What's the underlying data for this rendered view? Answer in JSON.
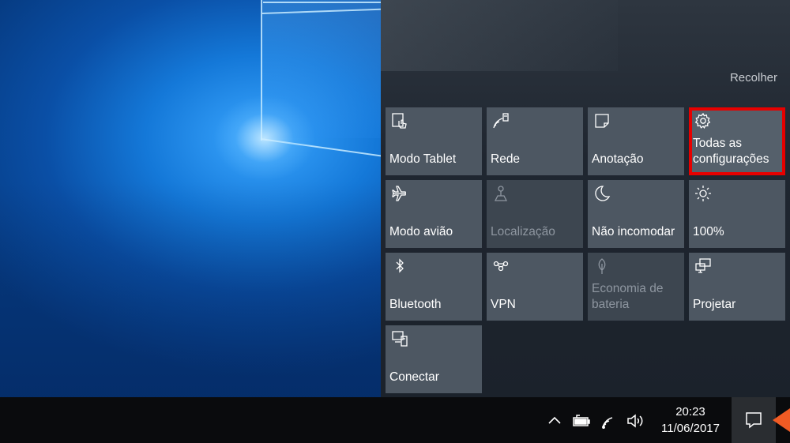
{
  "action_center": {
    "collapse_label": "Recolher",
    "tiles": [
      {
        "label": "Modo Tablet",
        "icon": "tablet-mode-icon",
        "state": "normal"
      },
      {
        "label": "Rede",
        "icon": "network-icon",
        "state": "normal"
      },
      {
        "label": "Anotação",
        "icon": "note-icon",
        "state": "normal"
      },
      {
        "label": "Todas as configurações",
        "icon": "gear-icon",
        "state": "highlighted"
      },
      {
        "label": "Modo avião",
        "icon": "airplane-icon",
        "state": "normal"
      },
      {
        "label": "Localização",
        "icon": "location-icon",
        "state": "disabled"
      },
      {
        "label": "Não incomodar",
        "icon": "moon-icon",
        "state": "normal"
      },
      {
        "label": "100%",
        "icon": "brightness-icon",
        "state": "normal"
      },
      {
        "label": "Bluetooth",
        "icon": "bluetooth-icon",
        "state": "normal"
      },
      {
        "label": "VPN",
        "icon": "vpn-icon",
        "state": "normal"
      },
      {
        "label": "Economia de bateria",
        "icon": "battery-saver-icon",
        "state": "disabled"
      },
      {
        "label": "Projetar",
        "icon": "project-icon",
        "state": "normal"
      },
      {
        "label": "Conectar",
        "icon": "connect-icon",
        "state": "normal"
      }
    ]
  },
  "taskbar": {
    "tray_icons": [
      "chevron-up-icon",
      "battery-icon",
      "wifi-icon",
      "volume-icon"
    ],
    "time": "20:23",
    "date": "11/06/2017",
    "notification_icon": "action-center-icon"
  },
  "colors": {
    "tile": "#4d5762",
    "tile_disabled": "#3d4650",
    "highlight": "#e60000",
    "taskbar": "#0a0b0d",
    "arrow_annotation": "#f05b24"
  }
}
